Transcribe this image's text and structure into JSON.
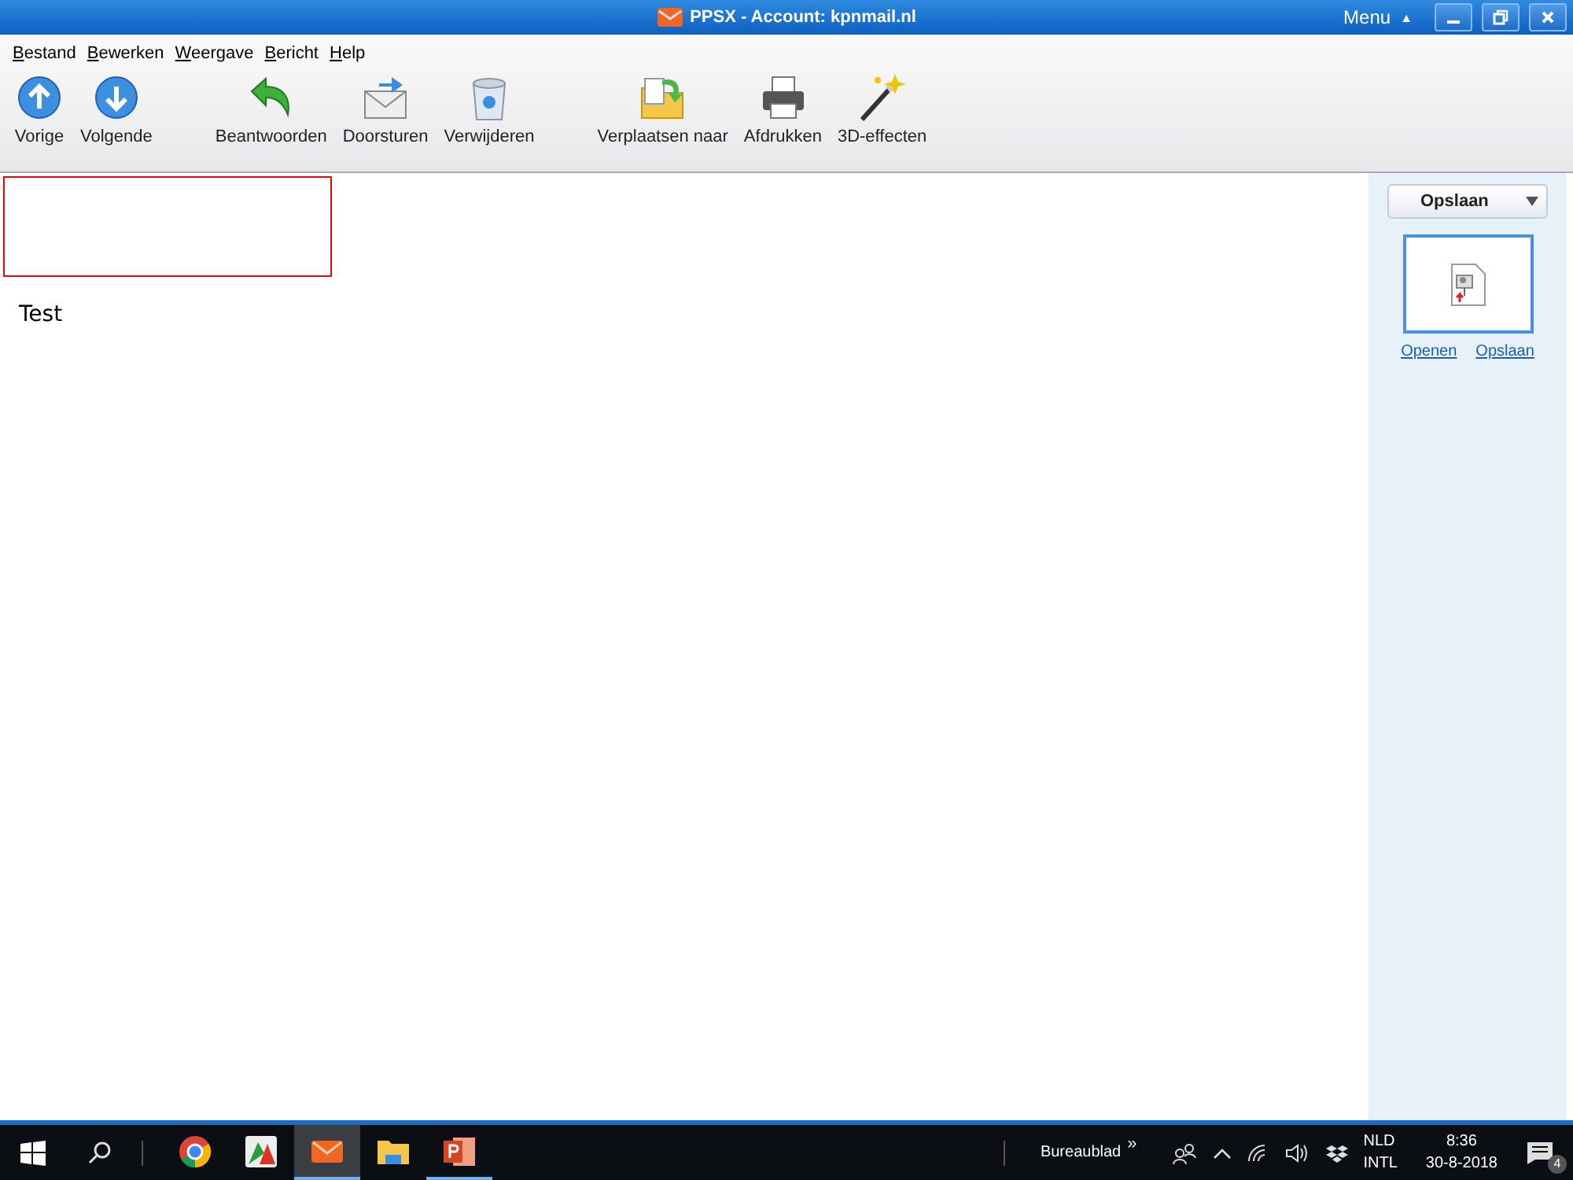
{
  "window": {
    "title": "PPSX - Account: kpnmail.nl",
    "menu_label": "Menu",
    "menu_arrow": "▲"
  },
  "menu_bar": [
    {
      "label": "Bestand"
    },
    {
      "label": "Bewerken"
    },
    {
      "label": "Weergave"
    },
    {
      "label": "Bericht"
    },
    {
      "label": "Help"
    }
  ],
  "toolbar": [
    [
      {
        "kind": "up",
        "label": "Vorige"
      },
      {
        "kind": "down",
        "label": "Volgende"
      }
    ],
    [
      {
        "kind": "reply",
        "label": "Beantwoorden"
      },
      {
        "kind": "forward",
        "label": "Doorsturen"
      },
      {
        "kind": "trash",
        "label": "Verwijderen"
      }
    ],
    [
      {
        "kind": "move",
        "label": "Verplaatsen naar"
      },
      {
        "kind": "print",
        "label": "Afdrukken"
      },
      {
        "kind": "wand",
        "label": "3D-effecten"
      }
    ]
  ],
  "message": {
    "body": "Test"
  },
  "sidebar": {
    "dropdown": "Opslaan",
    "attachment_links": [
      "Openen",
      "Opslaan"
    ]
  },
  "taskbar": {
    "apps": [
      {
        "kind": "chrome",
        "selected": false,
        "running": false
      },
      {
        "kind": "photo",
        "selected": false,
        "running": false
      },
      {
        "kind": "mail",
        "selected": true,
        "running": true
      },
      {
        "kind": "folder",
        "selected": false,
        "running": false
      },
      {
        "kind": "slides",
        "selected": false,
        "running": true
      }
    ],
    "toolbar_label": "Bureaublad",
    "toolbar_chevron": "»",
    "language": "NLD",
    "layout": "INTL",
    "time": "8:36",
    "date": "30-8-2018",
    "notification_count": "4"
  }
}
